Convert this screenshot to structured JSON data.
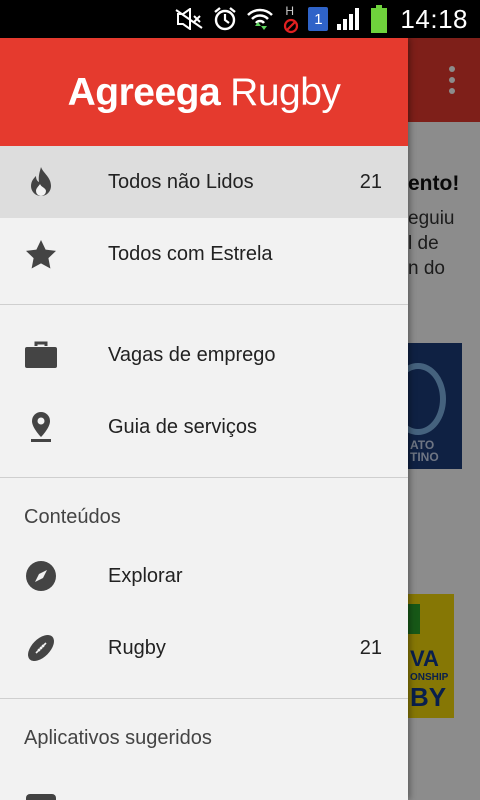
{
  "status_bar": {
    "time": "14:18",
    "notification_badge": "1",
    "network_letter": "H",
    "icons": [
      "mute-icon",
      "alarm-icon",
      "wifi-icon",
      "no-data-icon",
      "notification-icon",
      "signal-icon",
      "battery-icon"
    ]
  },
  "drawer": {
    "brand_part1": "Agreega",
    "brand_part2": "Rugby",
    "accent_color": "#e53a2e",
    "group1": [
      {
        "label": "Todos não Lidos",
        "count": "21",
        "icon": "fire-icon",
        "selected": true
      },
      {
        "label": "Todos com Estrela",
        "count": "",
        "icon": "star-icon",
        "selected": false
      }
    ],
    "group2": [
      {
        "label": "Vagas de emprego",
        "count": "",
        "icon": "briefcase-icon"
      },
      {
        "label": "Guia de serviços",
        "count": "",
        "icon": "location-pin-icon"
      }
    ],
    "contents_header": "Conteúdos",
    "contents": [
      {
        "label": "Explorar",
        "count": "",
        "icon": "compass-icon"
      },
      {
        "label": "Rugby",
        "count": "21",
        "icon": "rugby-ball-icon"
      }
    ],
    "suggested_header": "Aplicativos sugeridos"
  },
  "background_app": {
    "headline_fragment": "ento!",
    "text_fragments": "eguiu\nl de\nn do",
    "image1_caption": "ATO\nTINO",
    "image2_text": [
      "VA",
      "ONSHIP",
      "BY"
    ]
  }
}
